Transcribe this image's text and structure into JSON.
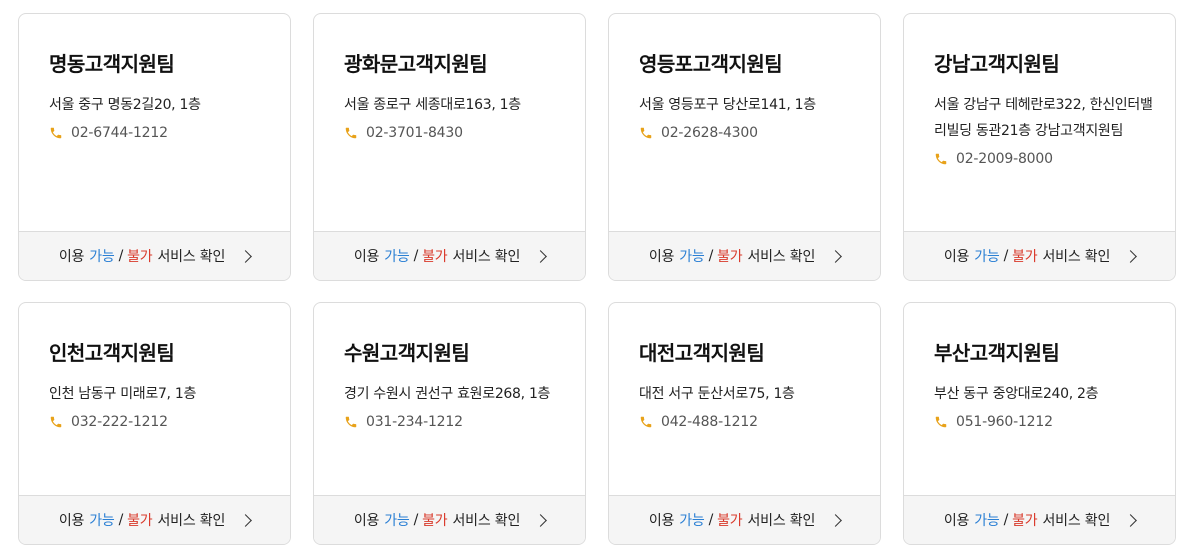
{
  "footer": {
    "prefix": "이용",
    "available": "가능",
    "separator": "/",
    "unavailable": "불가",
    "suffix": "서비스 확인"
  },
  "colors": {
    "available": "#2a7fd4",
    "unavailable": "#d93a2b",
    "phone_icon": "#e8a21a"
  },
  "centers": [
    {
      "title": "명동고객지원팀",
      "address": "서울 중구 명동2길20, 1층",
      "phone": "02-6744-1212"
    },
    {
      "title": "광화문고객지원팀",
      "address": "서울 종로구 세종대로163, 1층",
      "phone": "02-3701-8430"
    },
    {
      "title": "영등포고객지원팀",
      "address": "서울 영등포구 당산로141, 1층",
      "phone": "02-2628-4300"
    },
    {
      "title": "강남고객지원팀",
      "address": "서울 강남구 테헤란로322, 한신인터밸리빌딩 동관21층 강남고객지원팀",
      "phone": "02-2009-8000"
    },
    {
      "title": "인천고객지원팀",
      "address": "인천 남동구 미래로7, 1층",
      "phone": "032-222-1212"
    },
    {
      "title": "수원고객지원팀",
      "address": "경기 수원시 권선구 효원로268, 1층",
      "phone": "031-234-1212"
    },
    {
      "title": "대전고객지원팀",
      "address": "대전 서구 둔산서로75, 1층",
      "phone": "042-488-1212"
    },
    {
      "title": "부산고객지원팀",
      "address": "부산 동구 중앙대로240, 2층",
      "phone": "051-960-1212"
    }
  ]
}
